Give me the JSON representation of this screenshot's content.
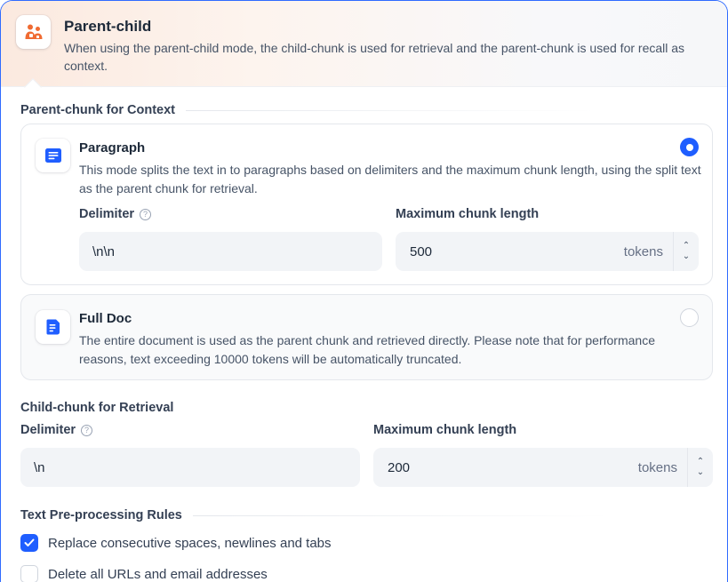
{
  "header": {
    "title": "Parent-child",
    "description": "When using the parent-child mode, the child-chunk is used for retrieval and the parent-chunk is used for recall as context.",
    "icon": "parent-child-icon",
    "accent": "#f06b32"
  },
  "parent_section": {
    "title": "Parent-chunk for Context",
    "options": [
      {
        "title": "Paragraph",
        "description": "This mode splits the text in to paragraphs based on delimiters and the maximum chunk length, using the split text as the parent chunk for retrieval.",
        "icon": "paragraph-icon",
        "selected": true,
        "delimiter_label": "Delimiter",
        "delimiter_value": "\\n\\n",
        "max_length_label": "Maximum chunk length",
        "max_length_value": "500",
        "unit": "tokens"
      },
      {
        "title": "Full Doc",
        "description": "The entire document is used as the parent chunk and retrieved directly. Please note that for performance reasons, text exceeding 10000 tokens will be automatically truncated.",
        "icon": "full-doc-icon",
        "selected": false
      }
    ]
  },
  "child_section": {
    "title": "Child-chunk for Retrieval",
    "delimiter_label": "Delimiter",
    "delimiter_value": "\\n",
    "max_length_label": "Maximum chunk length",
    "max_length_value": "200",
    "unit": "tokens"
  },
  "rules_section": {
    "title": "Text Pre-processing Rules",
    "rules": [
      {
        "label": "Replace consecutive spaces, newlines and tabs",
        "checked": true
      },
      {
        "label": "Delete all URLs and email addresses",
        "checked": false
      }
    ]
  },
  "colors": {
    "primary": "#1f5eff",
    "border_accent": "#2f6bff"
  }
}
